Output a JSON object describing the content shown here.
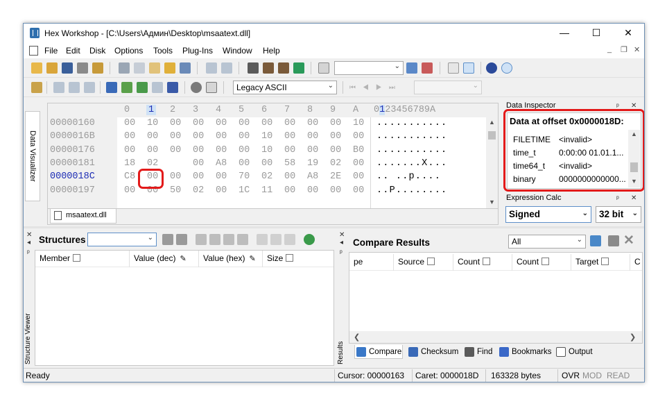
{
  "window": {
    "title": "Hex Workshop - [C:\\Users\\Админ\\Desktop\\msaatext.dll]",
    "minimize": "—",
    "maximize": "☐",
    "close": "✕"
  },
  "menu": [
    "File",
    "Edit",
    "Disk",
    "Options",
    "Tools",
    "Plug-Ins",
    "Window",
    "Help"
  ],
  "doc_controls": {
    "min": "_",
    "restore": "❐",
    "close": "✕"
  },
  "toolbar2": {
    "encoding": "Legacy ASCII"
  },
  "hex": {
    "ruler_hex": [
      "0",
      "1",
      "2",
      "3",
      "4",
      "5",
      "6",
      "7",
      "8",
      "9",
      "A"
    ],
    "ruler_ascii_pre": "0",
    "ruler_ascii_sel": "1",
    "ruler_ascii_post": "23456789A",
    "rows": [
      {
        "offset": "00000160",
        "bytes": [
          "00",
          "10",
          "00",
          "00",
          "00",
          "00",
          "00",
          "00",
          "00",
          "00",
          "10"
        ],
        "ascii": "..........."
      },
      {
        "offset": "0000016B",
        "bytes": [
          "00",
          "00",
          "00",
          "00",
          "00",
          "00",
          "10",
          "00",
          "00",
          "00",
          "00"
        ],
        "ascii": "..........."
      },
      {
        "offset": "00000176",
        "bytes": [
          "00",
          "00",
          "00",
          "00",
          "00",
          "00",
          "10",
          "00",
          "00",
          "00",
          "B0"
        ],
        "ascii": "..........."
      },
      {
        "offset": "00000181",
        "bytes": [
          "18",
          "02",
          "00",
          "A8",
          "00",
          "00",
          "58",
          "19",
          "02",
          "00"
        ],
        "ascii": ".......X..."
      },
      {
        "offset": "0000018C",
        "bytes": [
          "C8",
          "00",
          "00",
          "00",
          "00",
          "70",
          "02",
          "00",
          "A8",
          "2E",
          "00"
        ],
        "ascii": "..  ..p...."
      },
      {
        "offset": "00000197",
        "bytes": [
          "00",
          "00",
          "50",
          "02",
          "00",
          "1C",
          "11",
          "00",
          "00",
          "00",
          "00"
        ],
        "ascii": "..P........"
      }
    ],
    "file_tab": "msaatext.dll"
  },
  "data_visualizer": "Data Visualizer",
  "data_inspector": {
    "title": "Data Inspector",
    "header": "Data at offset 0x0000018D:",
    "rows": [
      {
        "name": "FILETIME",
        "value": "<invalid>"
      },
      {
        "name": "time_t",
        "value": "0:00:00 01.01.1..."
      },
      {
        "name": "time64_t",
        "value": "<invalid>"
      },
      {
        "name": "binary",
        "value": "0000000000000..."
      }
    ]
  },
  "expression_calc": {
    "title": "Expression Calc",
    "mode": "Signed",
    "bits": "32 bit"
  },
  "structures": {
    "title": "Structures",
    "columns": [
      "Member",
      "Value (dec)",
      "Value (hex)",
      "Size"
    ],
    "side_label": "Structure Viewer"
  },
  "compare": {
    "title": "Compare Results",
    "filter": "All",
    "columns": [
      "pe",
      "Source",
      "Count",
      "Count",
      "Target",
      "C"
    ],
    "side_label": "Results",
    "tabs": [
      "Compare",
      "Checksum",
      "Find",
      "Bookmarks",
      "Output"
    ]
  },
  "status": {
    "ready": "Ready",
    "cursor": "Cursor: 00000163",
    "caret": "Caret: 0000018D",
    "size": "163328 bytes",
    "ovr": "OVR",
    "mod": "MOD",
    "read": "READ"
  },
  "colors": {
    "highlight": "#e31a1a",
    "offset_blue": "#1c2cb4",
    "accent": "#2f6fae"
  }
}
